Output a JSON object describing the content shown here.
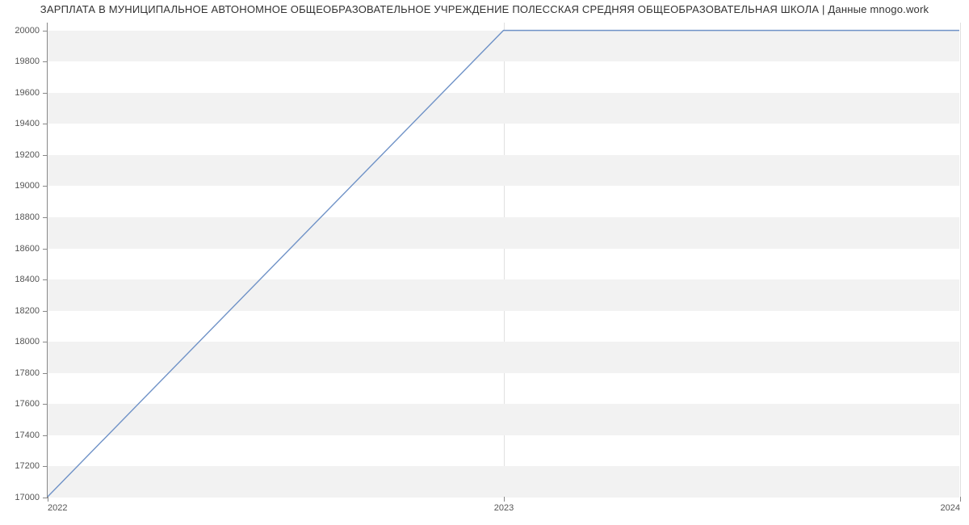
{
  "chart_data": {
    "type": "line",
    "title": "ЗАРПЛАТА В МУНИЦИПАЛЬНОЕ АВТОНОМНОЕ ОБЩЕОБРАЗОВАТЕЛЬНОЕ УЧРЕЖДЕНИЕ ПОЛЕССКАЯ СРЕДНЯЯ ОБЩЕОБРАЗОВАТЕЛЬНАЯ ШКОЛА | Данные mnogo.work",
    "xlabel": "",
    "ylabel": "",
    "x": [
      2022,
      2023,
      2024
    ],
    "values": [
      17000,
      20000,
      20000
    ],
    "x_ticks": [
      2022,
      2023,
      2024
    ],
    "y_ticks": [
      17000,
      17200,
      17400,
      17600,
      17800,
      18000,
      18200,
      18400,
      18600,
      18800,
      19000,
      19200,
      19400,
      19600,
      19800,
      20000
    ],
    "xlim": [
      2022,
      2024
    ],
    "ylim": [
      17000,
      20050
    ],
    "grid": true
  }
}
